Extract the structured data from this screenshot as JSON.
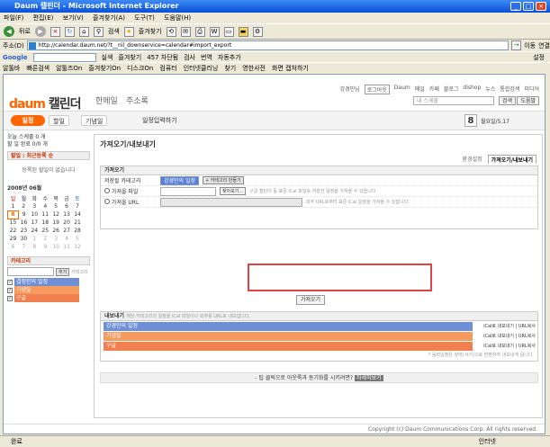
{
  "window": {
    "title": "Daum 캘린더 - Microsoft Internet Explorer"
  },
  "menu": [
    "파일(F)",
    "편집(E)",
    "보기(V)",
    "즐겨찾기(A)",
    "도구(T)",
    "도움말(H)"
  ],
  "toolbar": {
    "back": "뒤로",
    "search": "검색",
    "favorites": "즐겨찾기"
  },
  "address": {
    "label": "주소(D)",
    "url": "http://calendar.daum.net/?t__nil_downservice=calendar#import_export",
    "go": "이동",
    "links": "연결"
  },
  "gbar": {
    "google": "Google",
    "search_btn": "실색",
    "bookmarks": "즐겨찾기",
    "blocked": "457 차단됨",
    "check": "검사",
    "translate": "번역",
    "autofill": "자동추가",
    "settings": "설정"
  },
  "linkbar": {
    "items": [
      "알툴바",
      "빠른검색",
      "알툴즈On",
      "즐겨찾기On",
      "디스크On",
      "컴퓨터",
      "인터넷클리닝",
      "찾기",
      "영한사전",
      "화면 캡처하기"
    ],
    "search_placeholder": "검 색",
    "favorites": "즐겨찾기",
    "messenger": "스페이스"
  },
  "page": {
    "logo_d": "daum",
    "logo_k": "캘린더",
    "header_links": [
      "한메일",
      "주소록"
    ],
    "topnav": [
      "강경민님",
      "로그아웃",
      "Daum",
      "메일",
      "카페",
      "블로그",
      "dishop",
      "뉴스",
      "통합검색",
      "미디어"
    ],
    "search_placeholder": "내 스케줄",
    "search_btn": "검색",
    "help_btn": "도움말",
    "tabs": [
      "일정",
      "할일",
      "기념일",
      "일정입력하기"
    ],
    "date_num": "8",
    "date_text": "월요일/5.17",
    "sidebar": {
      "today_line1": "오늘 스케줄 0 개",
      "today_line2": "할 일 완료 0/0 개",
      "todo_head": "할일 : 최근등록 순",
      "todo_empty": "등록된 할일이 없습니다",
      "cal_title": "2008년 06월",
      "cal_days": [
        "일",
        "월",
        "화",
        "수",
        "목",
        "금",
        "토"
      ],
      "cal_rows": [
        [
          "1",
          "2",
          "3",
          "4",
          "5",
          "6",
          "7"
        ],
        [
          "8",
          "9",
          "10",
          "11",
          "12",
          "13",
          "14"
        ],
        [
          "15",
          "16",
          "17",
          "18",
          "19",
          "20",
          "21"
        ],
        [
          "22",
          "23",
          "24",
          "25",
          "26",
          "27",
          "28"
        ],
        [
          "29",
          "30",
          "1",
          "2",
          "3",
          "4",
          "5"
        ],
        [
          "6",
          "7",
          "8",
          "9",
          "10",
          "11",
          "12"
        ]
      ],
      "cat_head": "카테고리",
      "cat_add": "추가",
      "cat_manage": "카테고리",
      "categories": [
        {
          "name": "결정한의 일정",
          "color": "#6e8fd4"
        },
        {
          "name": "기념일",
          "color": "#f79a5e"
        },
        {
          "name": "구글",
          "color": "#f08050"
        }
      ]
    },
    "main_title": "가져오기/내보내기",
    "subtabs": [
      "환경설정",
      "가져오기/내보내기"
    ],
    "import": {
      "head": "가져오기",
      "row1_label": "저장될 카테고리",
      "row1_value": "강경민의 일정",
      "row1_btn": "+ 카테고리 만들기",
      "row2_label": "가져올 파일",
      "row2_btn": "찾아보기...",
      "row2_note": "구글 캘린더 등 표준 iCal 파일로 저장한 일정을 가져올 수 있습니다.",
      "row3_label": "가져올 URL",
      "row3_note": "외부 URL로부터 표준 iCal 일정을 가져올 수 있습니다.",
      "submit": "가져오기"
    },
    "export": {
      "head": "내보내기",
      "head_note": "해당 카테고리의 일정을 iCal 파일이나 외부용 URL로 내보냅니다.",
      "rows": [
        {
          "name": "강경민의 일정",
          "color": "#6e8fd4",
          "link": "iCal로 내보내기 | URL복사"
        },
        {
          "name": "기념일",
          "color": "#f79a5e",
          "link": "iCal로 내보내기 | URL복사"
        },
        {
          "name": "구글",
          "color": "#f08050",
          "link": "iCal로 내보내기 | URL복사"
        }
      ],
      "note": "* 음력일정은 양력(서기)으로 변환하여 내보내게 됩니다."
    },
    "foot_text": "- 팁 클릭으로 아웃룩과 동기화를 시키려면?",
    "foot_btn": "자세히보기",
    "page_footer": "Copyright (c) Daum Communications Corp. All rights reserved."
  },
  "status": {
    "text": "완료",
    "zone": "인터넷"
  }
}
